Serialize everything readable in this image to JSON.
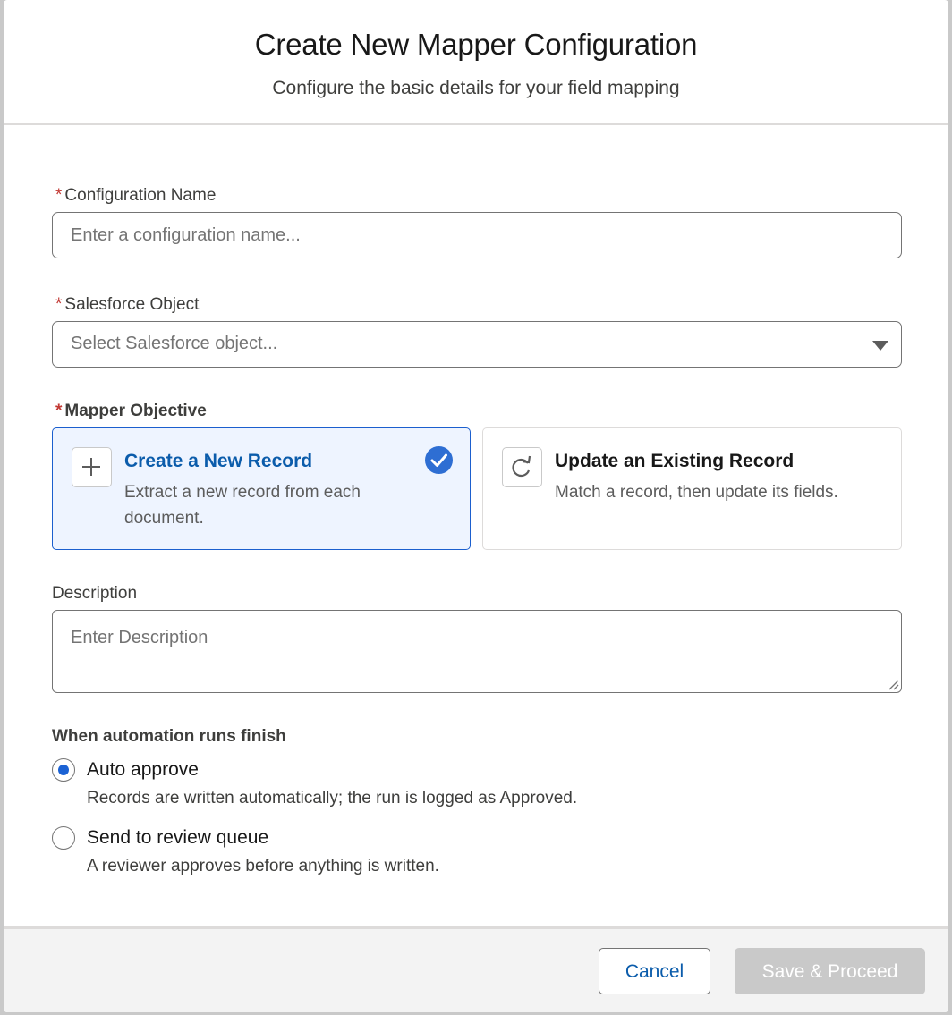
{
  "modal": {
    "title": "Create New Mapper Configuration",
    "subtitle": "Configure the basic details for your field mapping"
  },
  "form": {
    "required_marker": "*",
    "config_name": {
      "label": "Configuration Name",
      "placeholder": "Enter a configuration name..."
    },
    "salesforce_object": {
      "label": "Salesforce Object",
      "placeholder": "Select Salesforce object..."
    },
    "objective": {
      "label": "Mapper Objective",
      "options": [
        {
          "title": "Create a New Record",
          "description": "Extract a new record from each document.",
          "icon": "plus-icon",
          "selected": true
        },
        {
          "title": "Update an Existing Record",
          "description": "Match a record, then update its fields.",
          "icon": "refresh-icon",
          "selected": false
        }
      ]
    },
    "description": {
      "label": "Description",
      "placeholder": "Enter Description"
    },
    "finish": {
      "label": "When automation runs finish",
      "options": [
        {
          "label": "Auto approve",
          "help": "Records are written automatically; the run is logged as Approved.",
          "checked": true
        },
        {
          "label": "Send to review queue",
          "help": "A reviewer approves before anything is written.",
          "checked": false
        }
      ]
    }
  },
  "footer": {
    "cancel_label": "Cancel",
    "save_label": "Save & Proceed",
    "save_disabled": true
  },
  "colors": {
    "accent": "#0b5cab",
    "selected_card_bg": "#eef4ff",
    "required": "#c23934",
    "disabled_button": "#c9c9c9"
  }
}
